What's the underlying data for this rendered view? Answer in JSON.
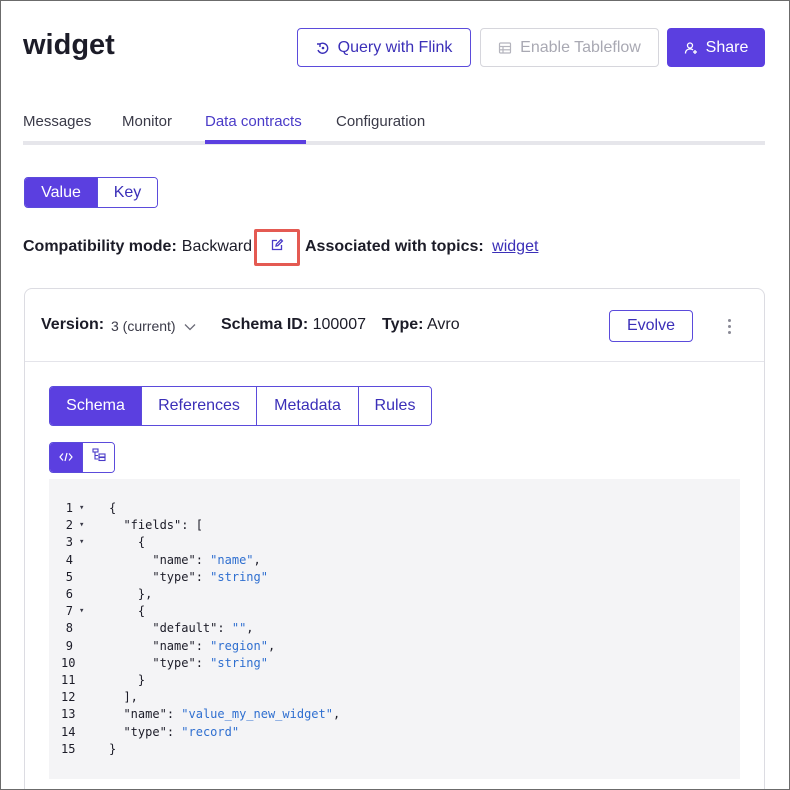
{
  "header": {
    "title": "widget",
    "query_button": "Query with Flink",
    "tableflow_button": "Enable Tableflow",
    "share_button": "Share"
  },
  "tabs": [
    {
      "label": "Messages",
      "active": false
    },
    {
      "label": "Monitor",
      "active": false
    },
    {
      "label": "Data contracts",
      "active": true
    },
    {
      "label": "Configuration",
      "active": false
    }
  ],
  "subject_toggle": [
    {
      "label": "Value",
      "active": true
    },
    {
      "label": "Key",
      "active": false
    }
  ],
  "compatibility": {
    "label": "Compatibility mode:",
    "value": "Backward",
    "assoc_label": "Associated with topics:",
    "assoc_topic": "widget"
  },
  "schema_card": {
    "version_label": "Version:",
    "version_value": "3 (current)",
    "schema_id_label": "Schema ID:",
    "schema_id_value": "100007",
    "type_label": "Type:",
    "type_value": "Avro",
    "evolve_button": "Evolve",
    "inner_tabs": [
      {
        "label": "Schema",
        "active": true
      },
      {
        "label": "References",
        "active": false
      },
      {
        "label": "Metadata",
        "active": false
      },
      {
        "label": "Rules",
        "active": false
      }
    ],
    "code_lines": [
      {
        "n": "1",
        "fold": true,
        "text": "{"
      },
      {
        "n": "2",
        "fold": true,
        "text": "  \"fields\": ["
      },
      {
        "n": "3",
        "fold": true,
        "text": "    {"
      },
      {
        "n": "4",
        "fold": false,
        "text": "      \"name\": \"name\","
      },
      {
        "n": "5",
        "fold": false,
        "text": "      \"type\": \"string\""
      },
      {
        "n": "6",
        "fold": false,
        "text": "    },"
      },
      {
        "n": "7",
        "fold": true,
        "text": "    {"
      },
      {
        "n": "8",
        "fold": false,
        "text": "      \"default\": \"\","
      },
      {
        "n": "9",
        "fold": false,
        "text": "      \"name\": \"region\","
      },
      {
        "n": "10",
        "fold": false,
        "text": "      \"type\": \"string\""
      },
      {
        "n": "11",
        "fold": false,
        "text": "    }"
      },
      {
        "n": "12",
        "fold": false,
        "text": "  ],"
      },
      {
        "n": "13",
        "fold": false,
        "text": "  \"name\": \"value_my_new_widget\","
      },
      {
        "n": "14",
        "fold": false,
        "text": "  \"type\": \"record\""
      },
      {
        "n": "15",
        "fold": false,
        "text": "}"
      }
    ]
  },
  "icons": {
    "query": "flink-query-icon",
    "tableflow": "tableflow-icon",
    "share": "add-user-icon",
    "edit": "edit-icon",
    "version_caret": "chevron-down-icon",
    "more": "kebab-menu-icon",
    "code_view": "code-icon",
    "tree_view": "tree-icon"
  },
  "colors": {
    "accent": "#5b3fe0",
    "accent_text": "#3b2fb8",
    "highlight": "#e45a52",
    "string": "#2f6fd0"
  }
}
